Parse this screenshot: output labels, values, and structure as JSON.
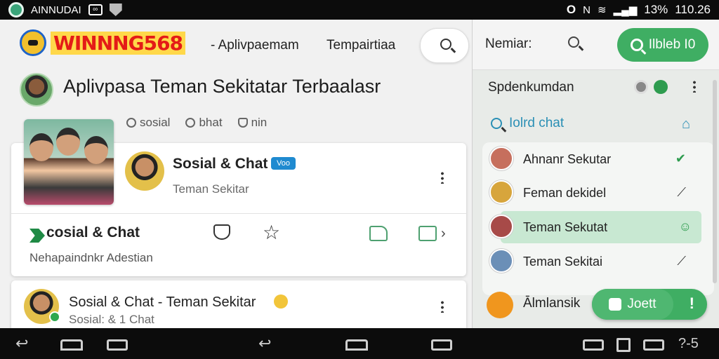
{
  "status_bar": {
    "app_name": "AINNUDAI",
    "box_glyph": "∞",
    "right_glyph": "O",
    "battery": "13%",
    "time": "110.26"
  },
  "header": {
    "logo_text": "WINNNG568",
    "link_1": "- Aplivpaemam",
    "link_2": "Tempairtiaa"
  },
  "profile": {
    "title": "Aplivpasa Teman Sekitatar Terbaalasr",
    "chips": [
      "sosial",
      "bhat",
      "nin"
    ]
  },
  "card1": {
    "title": "Sosial & Chat",
    "badge": "Voo",
    "subtitle": "Teman Sekitar",
    "section_title": "cosial & Chat",
    "section_sub": "Nehapaindnkr Adestian",
    "chevron": "›"
  },
  "card2": {
    "title": "Sosial & Chat - Teman Sekitar",
    "subtitle": "Sosial: & 1 Chat"
  },
  "right": {
    "search_label": "Nemiar:",
    "button_label": "Ilbleb I0",
    "section_label": "Spdenkumdan",
    "chat_link": "Iolrd chat",
    "list": [
      {
        "name": "Ahnanr Sekutar",
        "mark": "✔",
        "avatar_color": "#c66f5d"
      },
      {
        "name": "Feman dekidel",
        "mark": "⟋",
        "avatar_color": "#d7a53c"
      },
      {
        "name": "Teman Sekutat",
        "mark": "☺",
        "avatar_color": "#a74a48"
      },
      {
        "name": "Teman Sekitai",
        "mark": "⟋",
        "avatar_color": "#6b8fb7"
      }
    ],
    "bottom_label": "Ālmlansik",
    "join_label": "Joett",
    "join_bang": "!"
  },
  "nav_bar": {
    "right_text": "?-5"
  },
  "colors": {
    "accent_green": "#3fae63",
    "logo_red": "#e41b17",
    "badge_blue": "#1f8ad0"
  }
}
